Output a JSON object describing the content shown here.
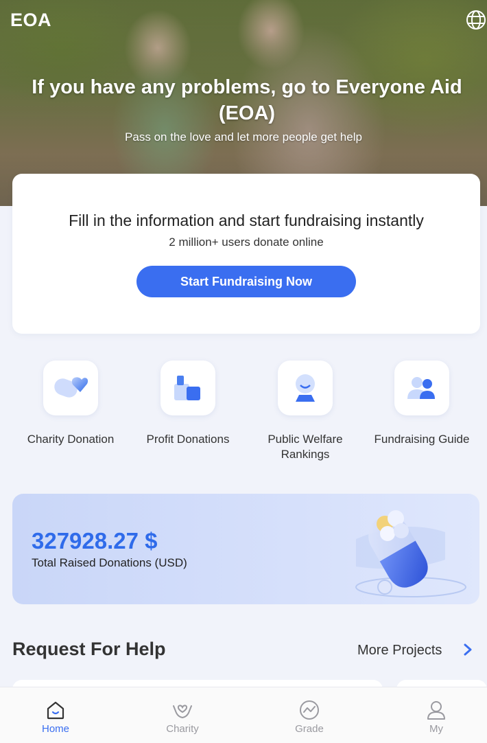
{
  "header": {
    "brand": "EOA",
    "language_icon": "globe-icon"
  },
  "hero": {
    "title": "If you have any problems, go to Everyone Aid (EOA)",
    "subtitle": "Pass on the love and let more people get help"
  },
  "fundraise_card": {
    "title": "Fill in the information and start fundraising instantly",
    "subtitle": "2 million+ users donate online",
    "button_label": "Start Fundraising Now"
  },
  "quick_actions": [
    {
      "label": "Charity Donation",
      "icon": "heart-pill-icon"
    },
    {
      "label": "Profit Donations",
      "icon": "bar-blocks-icon"
    },
    {
      "label": "Public Welfare Rankings",
      "icon": "person-ranking-icon"
    },
    {
      "label": "Fundraising Guide",
      "icon": "people-guide-icon"
    }
  ],
  "total": {
    "amount": "327928.27 $",
    "label": "Total Raised Donations (USD)"
  },
  "requests": {
    "title": "Request For Help",
    "more_label": "More Projects"
  },
  "bottom_nav": [
    {
      "label": "Home",
      "icon": "home-icon",
      "active": true
    },
    {
      "label": "Charity",
      "icon": "charity-hands-icon",
      "active": false
    },
    {
      "label": "Grade",
      "icon": "grade-chart-icon",
      "active": false
    },
    {
      "label": "My",
      "icon": "user-icon",
      "active": false
    }
  ],
  "colors": {
    "accent": "#3a6ef0",
    "amount": "#2f6bea",
    "background": "#f1f3fa"
  }
}
